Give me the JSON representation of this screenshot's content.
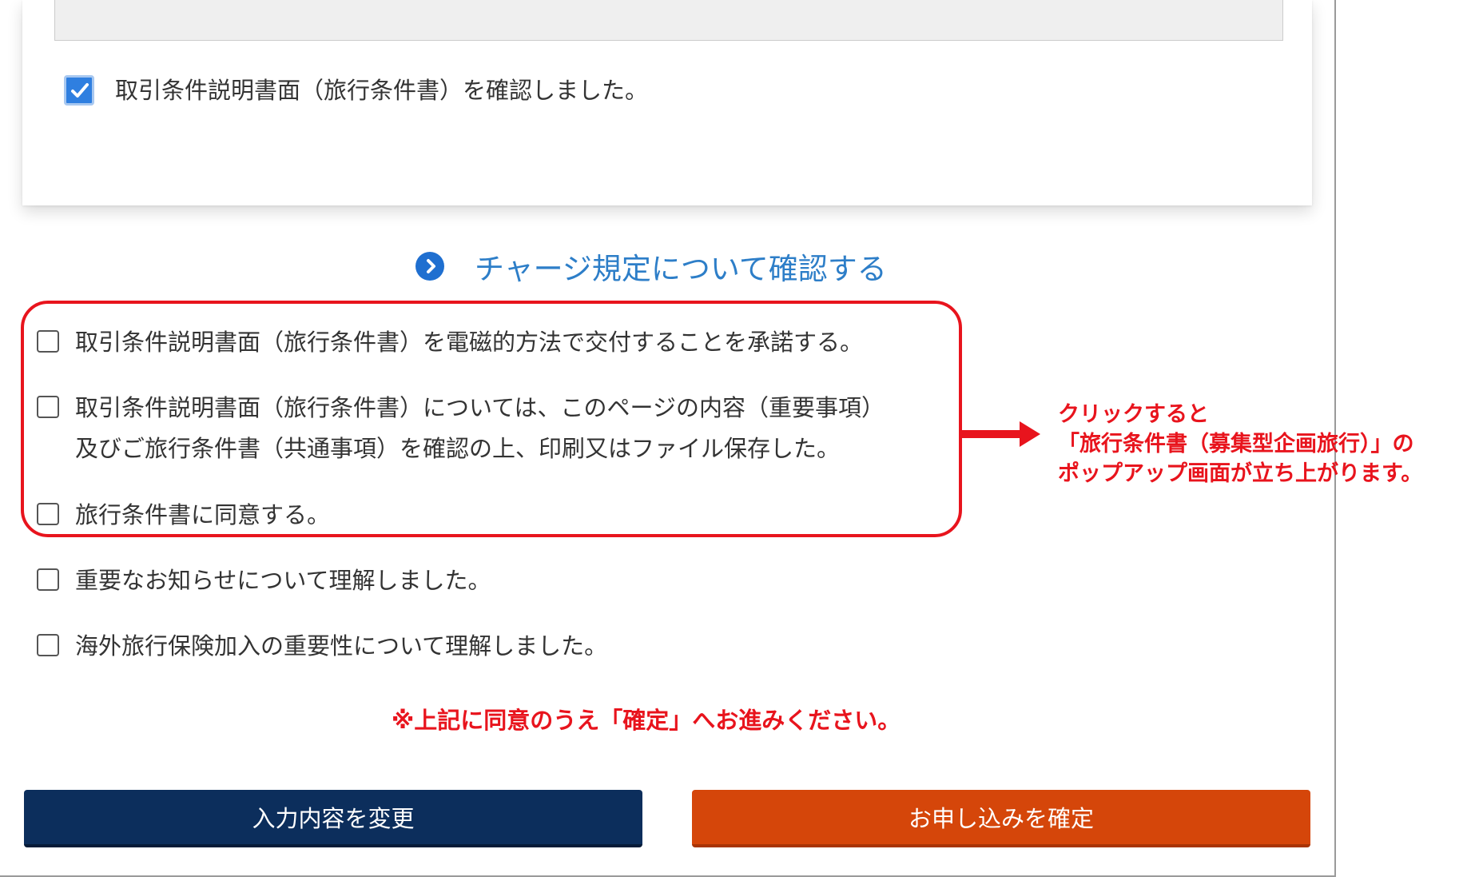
{
  "confirmation": {
    "label": "取引条件説明書面（旅行条件書）を確認しました。",
    "checked": true
  },
  "charge_link": {
    "label": "チャージ規定について確認する",
    "icon": "chevron-right-circle-icon"
  },
  "consents": [
    {
      "lines": [
        "取引条件説明書面（旅行条件書）を電磁的方法で交付することを承諾する。"
      ],
      "checked": false
    },
    {
      "lines": [
        "取引条件説明書面（旅行条件書）については、このページの内容（重要事項）",
        "及びご旅行条件書（共通事項）を確認の上、印刷又はファイル保存した。"
      ],
      "checked": false
    },
    {
      "lines": [
        "旅行条件書に同意する。"
      ],
      "checked": false
    },
    {
      "lines": [
        "重要なお知らせについて理解しました。"
      ],
      "checked": false
    },
    {
      "lines": [
        "海外旅行保険加入の重要性について理解しました。"
      ],
      "checked": false
    }
  ],
  "annotation": {
    "lines": [
      "クリックすると",
      "「旅行条件書（募集型企画旅行）」の",
      "ポップアップ画面が立ち上がります。"
    ]
  },
  "notice": "※上記に同意のうえ「確定」へお進みください。",
  "buttons": {
    "change": "入力内容を変更",
    "confirm": "お申し込みを確定"
  },
  "colors": {
    "link": "#2d7ec8",
    "highlight": "#e8141d",
    "change_button": "#0c2e5c",
    "confirm_button": "#d5460a"
  }
}
